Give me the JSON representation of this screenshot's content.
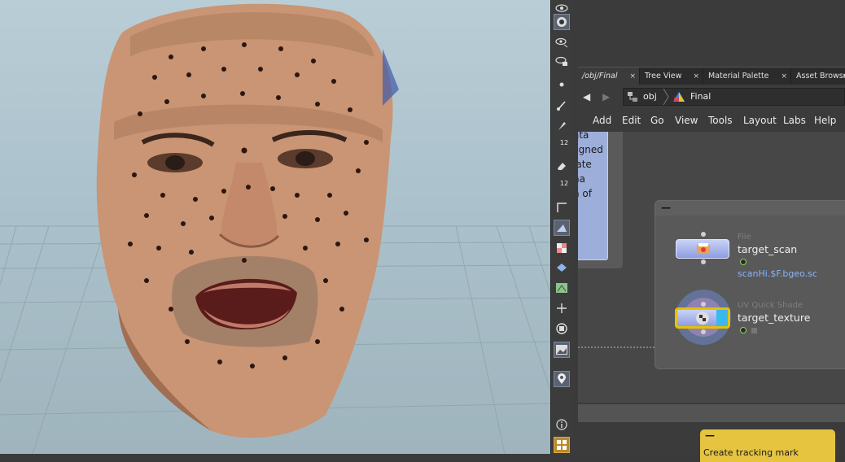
{
  "shelf_tools": [
    {
      "icon": "view-eye-icon"
    },
    {
      "icon": "render-camera-icon",
      "selected": true
    },
    {
      "icon": "eye-options-icon"
    },
    {
      "icon": "eye-camera-icon"
    },
    {
      "icon": "point-dot-icon"
    },
    {
      "icon": "brush-arrow-icon"
    },
    {
      "icon": "pin-tool-icon"
    },
    {
      "icon": "numbered-brush-icon",
      "label": "12"
    },
    {
      "icon": "eraser-icon"
    },
    {
      "icon": "numbered-eraser-icon",
      "label": "12"
    },
    {
      "icon": "corner-tool-icon"
    },
    {
      "icon": "snap-surface-icon",
      "selected": true
    },
    {
      "icon": "checker-texture-icon"
    },
    {
      "icon": "diamond-layer-icon"
    },
    {
      "icon": "uv-map-icon"
    },
    {
      "icon": "transform-arrows-icon"
    },
    {
      "icon": "circle-stop-icon"
    },
    {
      "icon": "image-viewer-icon",
      "selected": true
    },
    {
      "icon": "location-pin-icon",
      "selected": true
    },
    {
      "icon": "info-icon"
    },
    {
      "icon": "grid-layout-icon"
    }
  ],
  "tabs": [
    {
      "label": "/obj/Final",
      "close": "×"
    },
    {
      "label": "Tree View",
      "close": "×"
    },
    {
      "label": "Material Palette",
      "close": "×"
    },
    {
      "label": "Asset Browser",
      "close": "×"
    }
  ],
  "path": {
    "root": "obj",
    "current": "Final"
  },
  "menu": [
    "Add",
    "Edit",
    "Go",
    "View",
    "Tools",
    "Layout",
    "Labs",
    "Help"
  ],
  "sticky_note_lines": [
    "ata",
    "ligned",
    "late",
    "ha",
    "n of"
  ],
  "nodes": {
    "scan": {
      "type": "File",
      "name": "target_scan",
      "parm": "scanHi.$F.bgeo.sc"
    },
    "texture": {
      "type": "UV Quick Shade",
      "name": "target_texture"
    }
  },
  "network_box_minimize": "—",
  "sticky2": {
    "minimize": "—",
    "text": "Create tracking mark"
  },
  "colors": {
    "sticky_blue": "#9eaedb",
    "sticky_yellow": "#e6c440",
    "node_selected": "#e8c000",
    "parm_link": "#86b6ff"
  }
}
